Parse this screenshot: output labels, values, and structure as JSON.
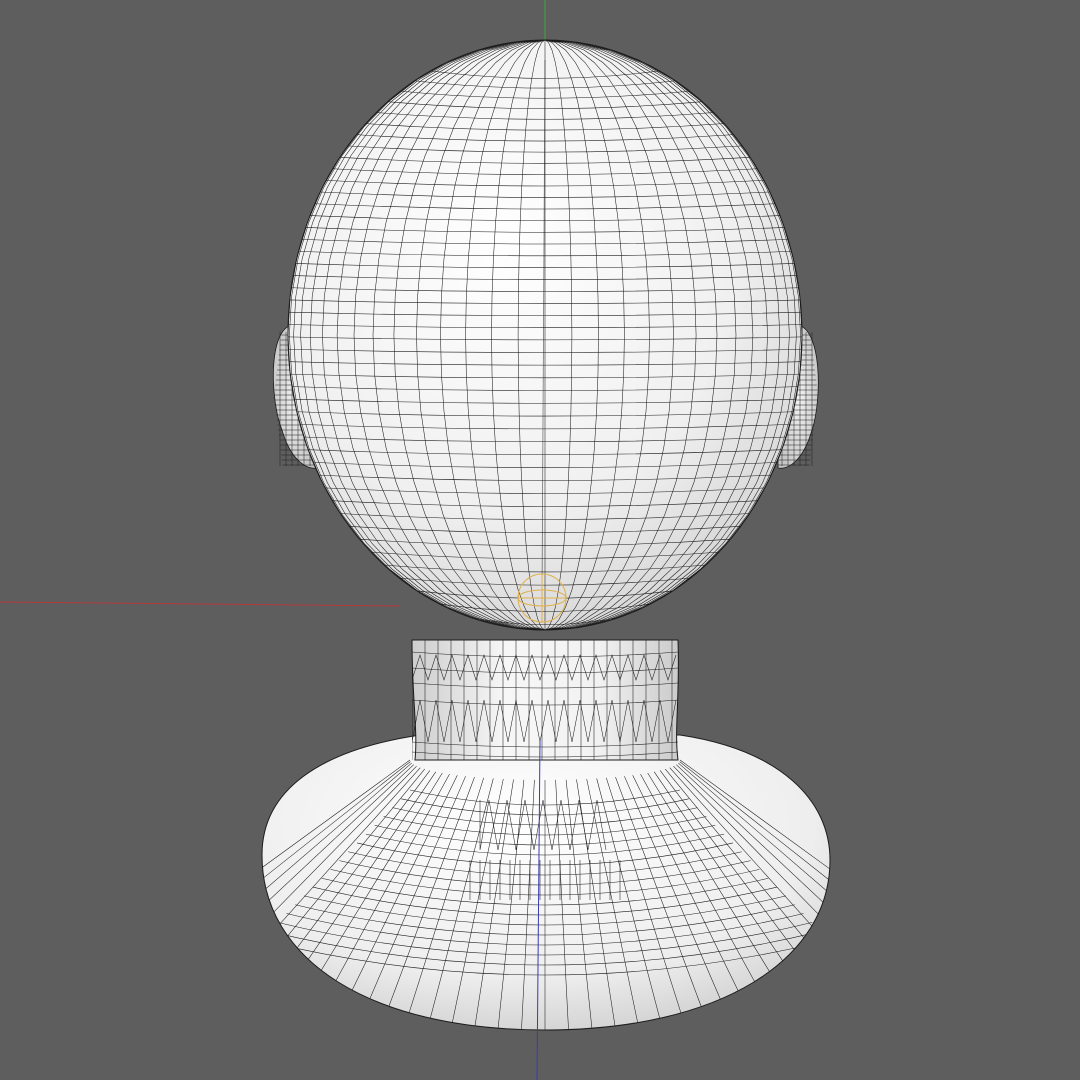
{
  "viewport": {
    "view": "back",
    "shading": "smooth-shaded-with-wireframe",
    "background_color": "#5e5e5e",
    "mesh_color": "#f4f4f4",
    "wire_color": "#1c1c1c"
  },
  "axes": {
    "x_axis_color": "#b53a3a",
    "y_axis_color": "#3fa83f",
    "z_axis_color": "#3a3ab5"
  },
  "model": {
    "kind": "head-bust",
    "parts": [
      "cranium",
      "left-ear",
      "right-ear",
      "neck",
      "base-pedestal"
    ]
  },
  "pivot": {
    "icon": "pivot-gizmo-icon",
    "color": "#e0b04a"
  }
}
